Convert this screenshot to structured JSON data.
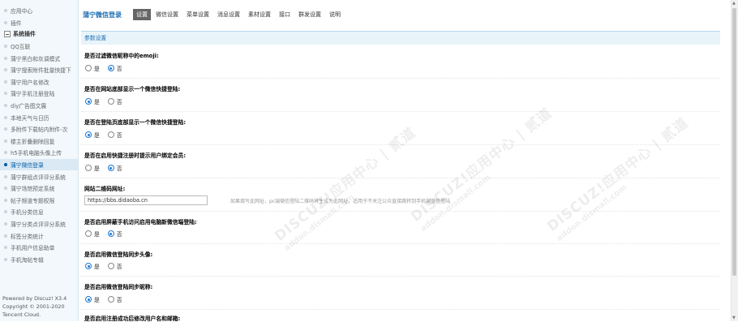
{
  "sidebar": {
    "items_top": [
      "应用中心",
      "插件"
    ],
    "group_label": "系统插件",
    "items_group": [
      "QQ互联"
    ],
    "items_plugins": [
      "蒲宁黑白和灰调模式",
      "蒲宁搜索附件批量快捷下",
      "蒲宁用户名修改",
      "蒲宁手机注册登陆",
      "diy广告图文展",
      "本地天气与日历",
      "多附件下载帖内附件-次",
      "楼主折叠删除回复",
      "h5手机电脑头像上传",
      "蒲宁微信登录",
      "蒲宁群组点评评分系统",
      "蒲宁场馆预定系统",
      "帖子频道专题权限",
      "手机分类信息",
      "蒲宁分类点评评分系统",
      "标签分类统计",
      "手机用户信息助单",
      "手机淘帖专辑"
    ],
    "active_item": "蒲宁微信登录",
    "footer": [
      "Powered by Discuz! X3.4",
      "Copyright © 2001-2020",
      "Tencent Cloud."
    ]
  },
  "header": {
    "title": "蒲宁微信登录",
    "tabs": [
      "设置",
      "微信设置",
      "菜单设置",
      "消息设置",
      "素材设置",
      "接口",
      "群发设置",
      "说明"
    ],
    "active_tab": "设置"
  },
  "main": {
    "section_title": "参数设置",
    "yes": "是",
    "no": "否",
    "fields": [
      {
        "label": "是否过滤微信昵称中的emoji:",
        "selected": "否"
      },
      {
        "label": "是否在网站底部显示一个微信快捷登陆:",
        "selected": "是"
      },
      {
        "label": "是否在登陆页底部显示一个微信快捷登陆:",
        "selected": "是"
      },
      {
        "label": "是否在启用快捷注册时提示用户绑定会员:",
        "selected": "否"
      },
      {
        "label": "网站二维码网址:",
        "value": "https://bbs.didaoba.cn",
        "hint": "如果填写此网址，pc端微信登陆二维码将生成为此网址，适用于不关注公众直接跳转到手机端微信登陆"
      },
      {
        "label": "是否启用屏蔽手机访问启用电脑新微信端登陆:",
        "selected": "否"
      },
      {
        "label": "是否启用微信登陆同步头像:",
        "selected": "是"
      },
      {
        "label": "是否启用微信登陆同步昵称:",
        "selected": "是"
      },
      {
        "label": "是否启用注册成功后修改用户名和邮箱:"
      }
    ]
  },
  "watermark": {
    "brand": "DISCUZ!应用中心 | 贰道",
    "domain": "addon.dismall.com"
  },
  "icons": {
    "radio": "radio-icon",
    "group_toggle": "minus-box-icon",
    "list_bullet": "dot-icon"
  },
  "colors": {
    "accent": "#1e6fb4",
    "section_bg": "#e8f4fa",
    "sidebar_bg": "#f2f8fc",
    "active_tab_bg": "#666666"
  }
}
